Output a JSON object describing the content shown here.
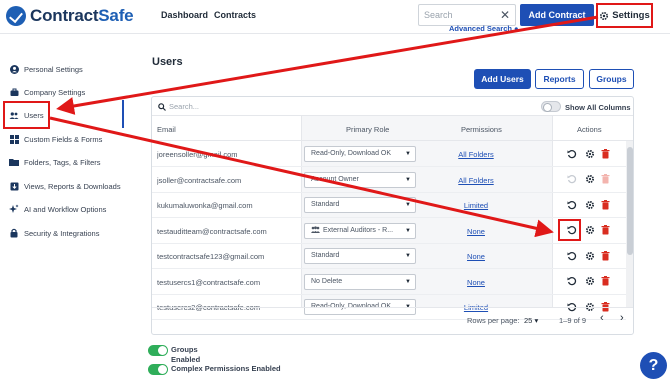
{
  "header": {
    "logo_prefix": "Contract",
    "logo_suffix": "Safe",
    "nav": [
      "Dashboard",
      "Contracts"
    ],
    "search_placeholder": "Search",
    "add_contract_label": "Add Contract",
    "advanced_search_label": "Advanced Search",
    "settings_label": "Settings"
  },
  "sidebar": {
    "items": [
      {
        "label": "Personal Settings",
        "icon": "person-icon"
      },
      {
        "label": "Company Settings",
        "icon": "briefcase-icon"
      },
      {
        "label": "Users",
        "icon": "users-icon"
      },
      {
        "label": "Custom Fields & Forms",
        "icon": "grid-icon"
      },
      {
        "label": "Folders, Tags, & Filters",
        "icon": "folder-icon"
      },
      {
        "label": "Views, Reports & Downloads",
        "icon": "download-icon"
      },
      {
        "label": "AI and Workflow Options",
        "icon": "sparkle-icon"
      },
      {
        "label": "Security & Integrations",
        "icon": "lock-icon"
      }
    ],
    "active": "Users"
  },
  "page": {
    "title": "Users",
    "buttons": {
      "users": "Add Users",
      "reports": "Reports",
      "groups": "Groups"
    }
  },
  "table": {
    "search_placeholder": "Search...",
    "show_all_label": "Show All Columns",
    "columns": {
      "email": "Email",
      "role": "Primary Role",
      "permissions": "Permissions",
      "actions": "Actions"
    },
    "rows": [
      {
        "email": "joreensoller@gmail.com",
        "role": "Read-Only, Download OK",
        "permissions": "All Folders"
      },
      {
        "email": "jsoller@contractsafe.com",
        "role": "Account Owner",
        "permissions": "All Folders"
      },
      {
        "email": "kukumaluwonka@gmail.com",
        "role": "Standard",
        "permissions": "Limited"
      },
      {
        "email": "testauditteam@contractsafe.com",
        "role": "External Auditors - R...",
        "permissions": "None"
      },
      {
        "email": "testcontractsafe123@gmail.com",
        "role": "Standard",
        "permissions": "None"
      },
      {
        "email": "testusercs1@contractsafe.com",
        "role": "No Delete",
        "permissions": "None"
      },
      {
        "email": "testusercs2@contractsafe.com",
        "role": "Read-Only, Download OK",
        "permissions": "Limited"
      }
    ],
    "footer": {
      "rows_per_page_label": "Rows per page:",
      "rows_per_page": "25",
      "range": "1–9 of 9"
    }
  },
  "features": [
    {
      "label_line1": "Groups",
      "label_line2": "Enabled"
    },
    {
      "label_line1": "Complex Permissions Enabled",
      "label_line2": ""
    }
  ],
  "help_label": "?",
  "colors": {
    "primary": "#1e4fb5",
    "annotation": "#e01818",
    "toggle_on": "#2fae5a",
    "delete": "#d92d20"
  }
}
